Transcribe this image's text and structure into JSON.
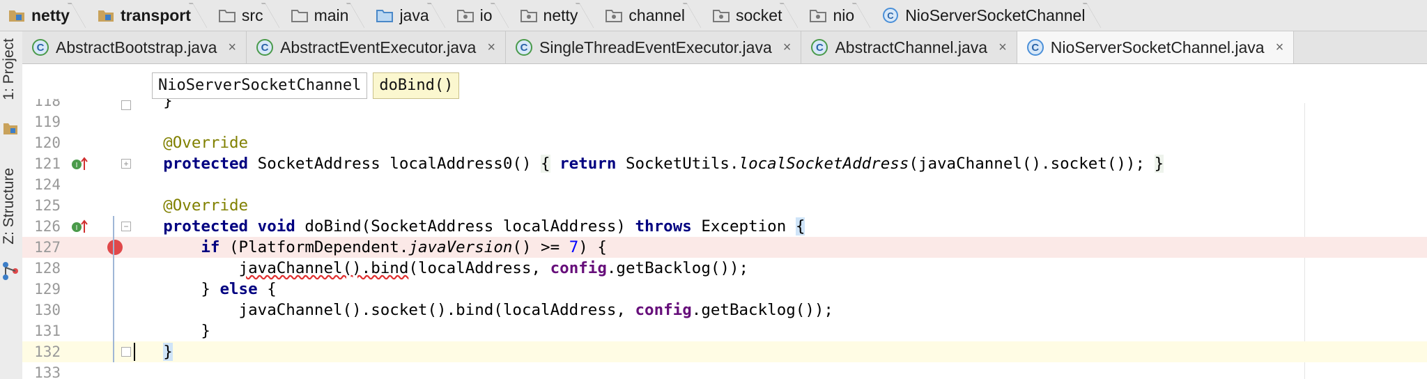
{
  "breadcrumb": [
    {
      "label": "netty",
      "icon": "module-folder-icon",
      "bold": true
    },
    {
      "label": "transport",
      "icon": "module-folder-icon",
      "bold": true
    },
    {
      "label": "src",
      "icon": "folder-icon",
      "bold": false
    },
    {
      "label": "main",
      "icon": "folder-icon",
      "bold": false
    },
    {
      "label": "java",
      "icon": "source-folder-icon",
      "bold": false
    },
    {
      "label": "io",
      "icon": "package-icon",
      "bold": false
    },
    {
      "label": "netty",
      "icon": "package-icon",
      "bold": false
    },
    {
      "label": "channel",
      "icon": "package-icon",
      "bold": false
    },
    {
      "label": "socket",
      "icon": "package-icon",
      "bold": false
    },
    {
      "label": "nio",
      "icon": "package-icon",
      "bold": false
    },
    {
      "label": "NioServerSocketChannel",
      "icon": "class-icon",
      "bold": false
    }
  ],
  "tool_windows": {
    "project": "1: Project",
    "structure": "Z: Structure"
  },
  "tabs": [
    {
      "label": "AbstractBootstrap.java",
      "close": "×"
    },
    {
      "label": "AbstractEventExecutor.java",
      "close": "×"
    },
    {
      "label": "SingleThreadEventExecutor.java",
      "close": "×"
    },
    {
      "label": "AbstractChannel.java",
      "close": "×"
    },
    {
      "label": "NioServerSocketChannel.java",
      "close": "×"
    }
  ],
  "editor_breadcrumb": {
    "class": "NioServerSocketChannel",
    "method": "doBind()"
  },
  "lines": [
    {
      "num": "118",
      "text": "    }"
    },
    {
      "num": "119",
      "text": ""
    },
    {
      "num": "120",
      "text": "    @Override"
    },
    {
      "num": "121",
      "text": "    protected SocketAddress localAddress0() { return SocketUtils.localSocketAddress(javaChannel().socket()); }"
    },
    {
      "num": "124",
      "text": ""
    },
    {
      "num": "125",
      "text": "    @Override"
    },
    {
      "num": "126",
      "text": "    protected void doBind(SocketAddress localAddress) throws Exception {"
    },
    {
      "num": "127",
      "text": "        if (PlatformDependent.javaVersion() >= 7) {"
    },
    {
      "num": "128",
      "text": "            javaChannel().bind(localAddress, config.getBacklog());"
    },
    {
      "num": "129",
      "text": "        } else {"
    },
    {
      "num": "130",
      "text": "            javaChannel().socket().bind(localAddress, config.getBacklog());"
    },
    {
      "num": "131",
      "text": "        }"
    },
    {
      "num": "132",
      "text": "    }"
    },
    {
      "num": "133",
      "text": ""
    }
  ],
  "colors": {
    "keyword": "#000080",
    "annotation": "#808000",
    "field": "#660e7a",
    "number": "#0000ff",
    "breakpoint_line": "#fbe9e7",
    "caret_line": "#fffce4",
    "breakpoint": "#e0484a"
  }
}
